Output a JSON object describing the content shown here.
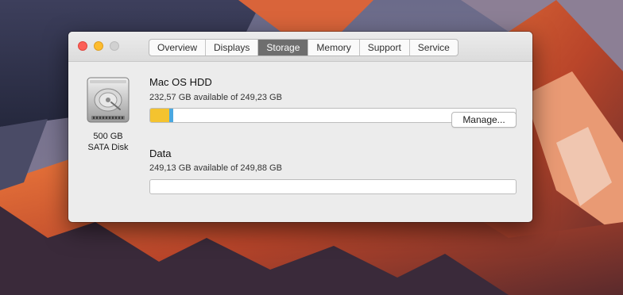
{
  "tabs": [
    {
      "label": "Overview",
      "active": false
    },
    {
      "label": "Displays",
      "active": false
    },
    {
      "label": "Storage",
      "active": true
    },
    {
      "label": "Memory",
      "active": false
    },
    {
      "label": "Support",
      "active": false
    },
    {
      "label": "Service",
      "active": false
    }
  ],
  "disk": {
    "size": "500 GB",
    "type": "SATA Disk",
    "icon": "hard-disk-icon"
  },
  "volumes": [
    {
      "name": "Mac OS HDD",
      "available": "232,57 GB available of 249,23 GB",
      "usage_segments": [
        {
          "category": "apps",
          "fraction": 0.052,
          "color": "#f4c32f"
        },
        {
          "category": "other",
          "fraction": 0.011,
          "color": "#4aa8e0"
        }
      ]
    },
    {
      "name": "Data",
      "available": "249,13 GB available of 249,88 GB",
      "usage_segments": []
    }
  ],
  "manage_button": "Manage...",
  "colors": {
    "accent_tab": "#6e6e6e",
    "apps": "#f4c32f",
    "other": "#4aa8e0"
  }
}
